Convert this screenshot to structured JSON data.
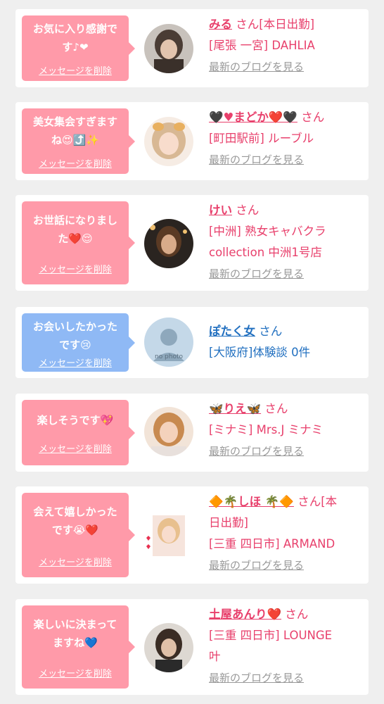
{
  "delete_label": "メッセージを削除",
  "blog_label": "最新のブログを見る",
  "colors": {
    "background": "#efefef",
    "card": "#ffffff",
    "bubble_pink": "#ff9aa9",
    "bubble_blue": "#8fb9f5",
    "name_pink": "#e8406c",
    "name_blue": "#2270c0",
    "link_gray": "#999999"
  },
  "messages": [
    {
      "bubble_line1": "お気に入り感謝で",
      "bubble_line2": "す♪❤",
      "name": "みる",
      "suffix": "さん[本日出勤]",
      "tag": "[尾張 一宮] DAHLIA"
    },
    {
      "bubble_line1": "美女集会すぎます",
      "bubble_line2": "ね😍⤴️✨",
      "name": "🖤♥まどか❤️🖤",
      "suffix": "さん",
      "tag": "[町田駅前] ルーブル"
    },
    {
      "bubble_line1": "お世話になりまし",
      "bubble_line2": "た❤️😌",
      "name": "けい",
      "suffix": "さん",
      "tag_line1": "[中洲] 熟女キャバクラ",
      "tag_line2": "collection 中洲1号店"
    },
    {
      "bubble_line1": "お会いしたかった",
      "bubble_line2": "です😢",
      "name": "ぽたく女",
      "suffix": "さん",
      "tag": "[大阪府]体験談 0件",
      "avatar_text": "no photo"
    },
    {
      "bubble_line1": "楽しそうです💖",
      "name": "🦋りえ🦋",
      "suffix": "さん",
      "tag": "[ミナミ] Mrs.J ミナミ"
    },
    {
      "bubble_line1": "会えて嬉しかった",
      "bubble_line2": "です😭❤️",
      "name": "🔶🌴しほ 🌴🔶",
      "suffix": "さん[本",
      "suffix2": "日出勤]",
      "tag": "[三重 四日市] ARMAND"
    },
    {
      "bubble_line1": "楽しいに決まって",
      "bubble_line2": "ますね💙",
      "name": "土屋あんり❤️",
      "suffix": "さん",
      "tag_line1": "[三重 四日市] LOUNGE",
      "tag_line2": "叶"
    }
  ]
}
